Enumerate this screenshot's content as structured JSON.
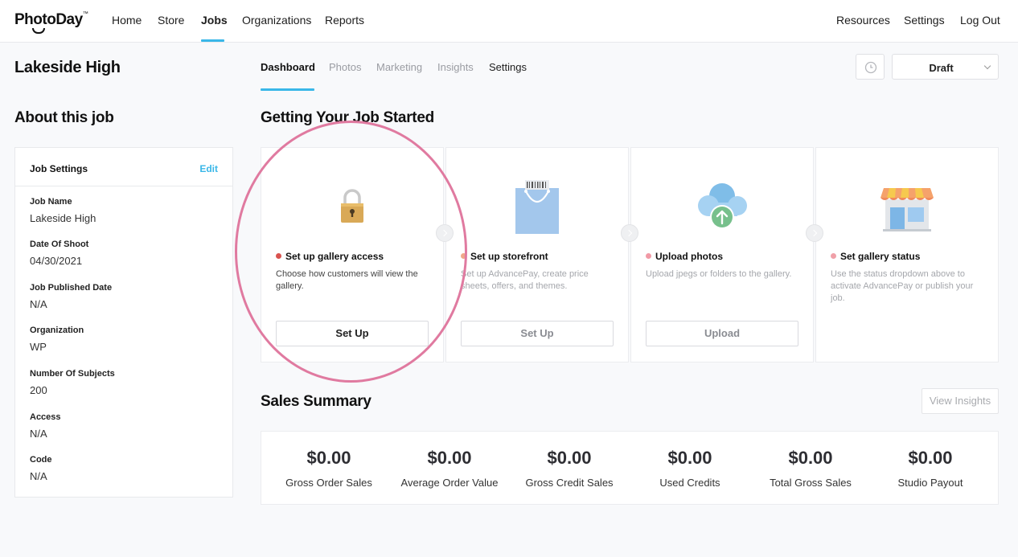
{
  "brand": {
    "logo_text": "PhotoDay",
    "tm": "™"
  },
  "topnav": {
    "left": [
      "Home",
      "Store",
      "Jobs",
      "Organizations",
      "Reports"
    ],
    "right": [
      "Resources",
      "Settings",
      "Log Out"
    ],
    "active": "Jobs"
  },
  "job": {
    "title": "Lakeside High"
  },
  "subtabs": [
    "Dashboard",
    "Photos",
    "Marketing",
    "Insights",
    "Settings"
  ],
  "status_select": {
    "value": "Draft"
  },
  "about": {
    "title": "About this job",
    "card_title": "Job Settings",
    "edit_label": "Edit",
    "fields": [
      {
        "label": "Job Name",
        "value": "Lakeside High"
      },
      {
        "label": "Date Of Shoot",
        "value": "04/30/2021"
      },
      {
        "label": "Job Published Date",
        "value": "N/A"
      },
      {
        "label": "Organization",
        "value": "WP"
      },
      {
        "label": "Number Of Subjects",
        "value": "200"
      },
      {
        "label": "Access",
        "value": "N/A"
      },
      {
        "label": "Code",
        "value": "N/A"
      }
    ]
  },
  "getting_started": {
    "title": "Getting Your Job Started",
    "steps": [
      {
        "title": "Set up gallery access",
        "desc": "Choose how customers will view the gallery.",
        "button": "Set Up",
        "icon": "lock-icon",
        "dot_color": "#d9534f"
      },
      {
        "title": "Set up storefront",
        "desc": "Set up AdvancePay, create price sheets, offers, and themes.",
        "button": "Set Up",
        "icon": "shopping-bag-icon",
        "dot_color": "#f0a98a"
      },
      {
        "title": "Upload photos",
        "desc": "Upload jpegs or folders to the gallery.",
        "button": "Upload",
        "icon": "cloud-upload-icon",
        "dot_color": "#f19aa6"
      },
      {
        "title": "Set gallery status",
        "desc": "Use the status dropdown above to activate AdvancePay or publish your job.",
        "button": "",
        "icon": "storefront-icon",
        "dot_color": "#f0a0a8"
      }
    ]
  },
  "sales": {
    "title": "Sales Summary",
    "view_insights": "View Insights",
    "metrics": [
      {
        "amount": "$0.00",
        "label": "Gross Order Sales"
      },
      {
        "amount": "$0.00",
        "label": "Average Order Value"
      },
      {
        "amount": "$0.00",
        "label": "Gross Credit Sales"
      },
      {
        "amount": "$0.00",
        "label": "Used Credits"
      },
      {
        "amount": "$0.00",
        "label": "Total Gross Sales"
      },
      {
        "amount": "$0.00",
        "label": "Studio Payout"
      }
    ]
  },
  "colors": {
    "accent": "#3ab7e8",
    "highlight_ring": "#e07aa0"
  }
}
